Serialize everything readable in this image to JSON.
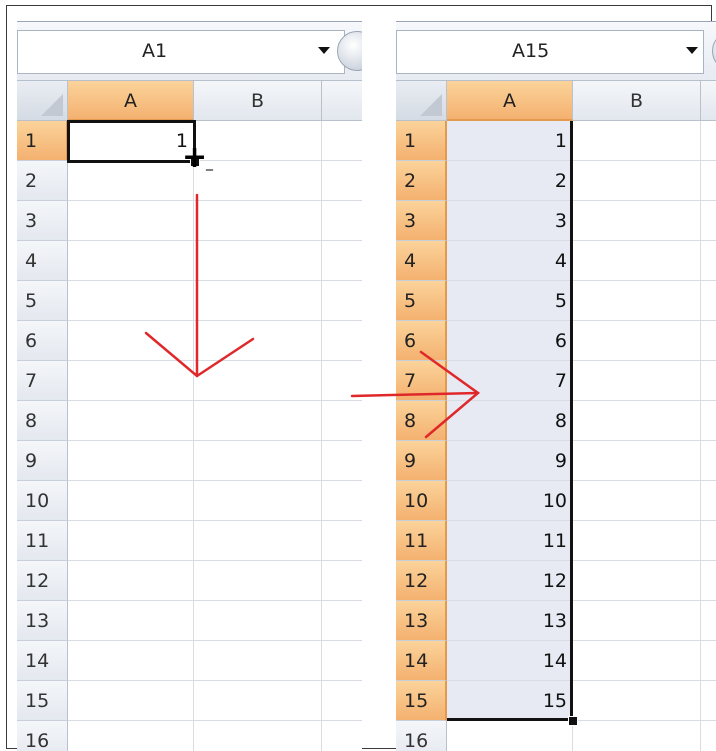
{
  "left": {
    "namebox": "A1",
    "columns": [
      "A",
      "B"
    ],
    "rows": [
      "1",
      "2",
      "3",
      "4",
      "5",
      "6",
      "7",
      "8",
      "9",
      "10",
      "11",
      "12",
      "13",
      "14",
      "15",
      "16"
    ],
    "a1_value": "1"
  },
  "right": {
    "namebox": "A15",
    "columns": [
      "A",
      "B"
    ],
    "rows": [
      "1",
      "2",
      "3",
      "4",
      "5",
      "6",
      "7",
      "8",
      "9",
      "10",
      "11",
      "12",
      "13",
      "14",
      "15",
      "16"
    ],
    "values": [
      "1",
      "2",
      "3",
      "4",
      "5",
      "6",
      "7",
      "8",
      "9",
      "10",
      "11",
      "12",
      "13",
      "14",
      "15"
    ]
  },
  "colors": {
    "arrow": "#e0282a",
    "selection_fill": "#e7eaf3",
    "header_active": "#f4b170"
  },
  "icons": {
    "fill_cursor": "crosshair-plus-icon",
    "dropdown": "chevron-down-icon"
  }
}
